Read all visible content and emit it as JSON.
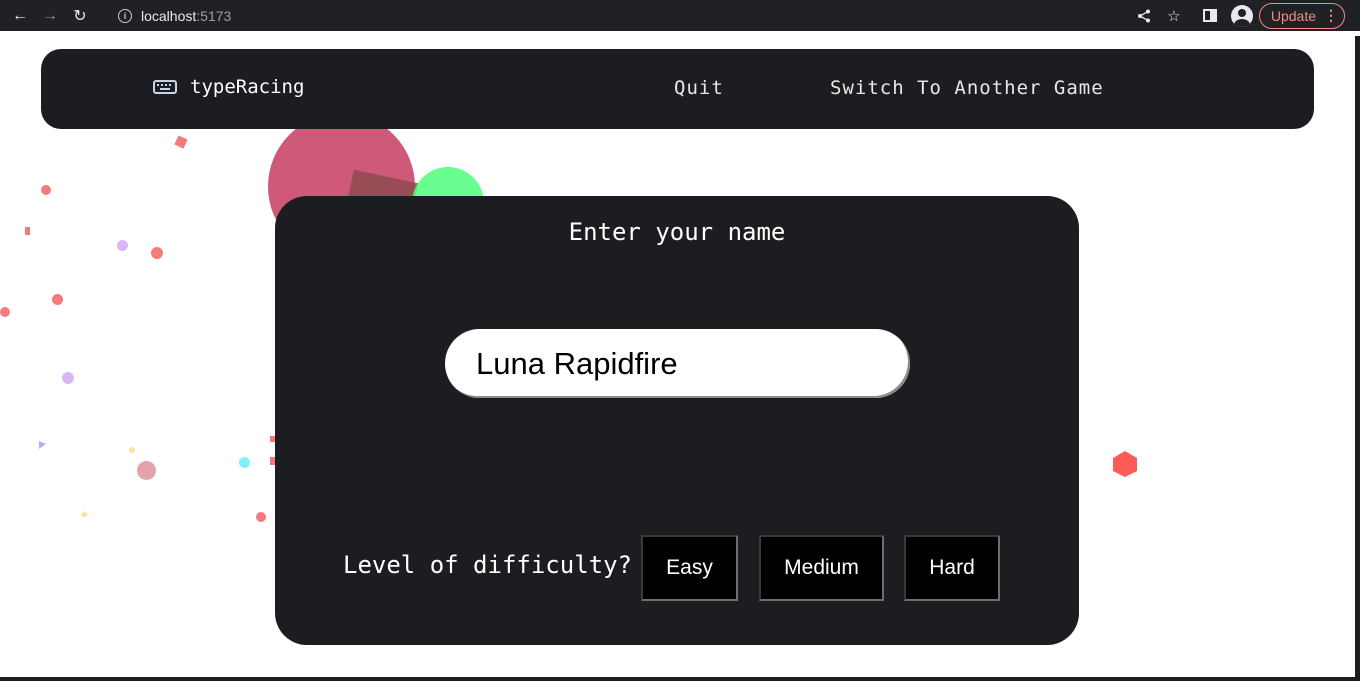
{
  "browser": {
    "url_host": "localhost",
    "url_port": ":5173",
    "update_label": "Update"
  },
  "navbar": {
    "brand": "typeRacing",
    "quit": "Quit",
    "switch_game": "Switch To Another Game"
  },
  "card": {
    "title": "Enter your name",
    "name_value": "Luna Rapidfire",
    "difficulty_label": "Level of difficulty?",
    "difficulty_options": [
      "Easy",
      "Medium",
      "Hard"
    ]
  },
  "colors": {
    "panel": "#1b1d21",
    "update_accent": "#f28b82",
    "confetti": [
      "#c84266",
      "#4dff7c",
      "#f47b7b",
      "#d9b6f7",
      "#7ff0ff",
      "#f6e39b",
      "#ff5555"
    ]
  }
}
